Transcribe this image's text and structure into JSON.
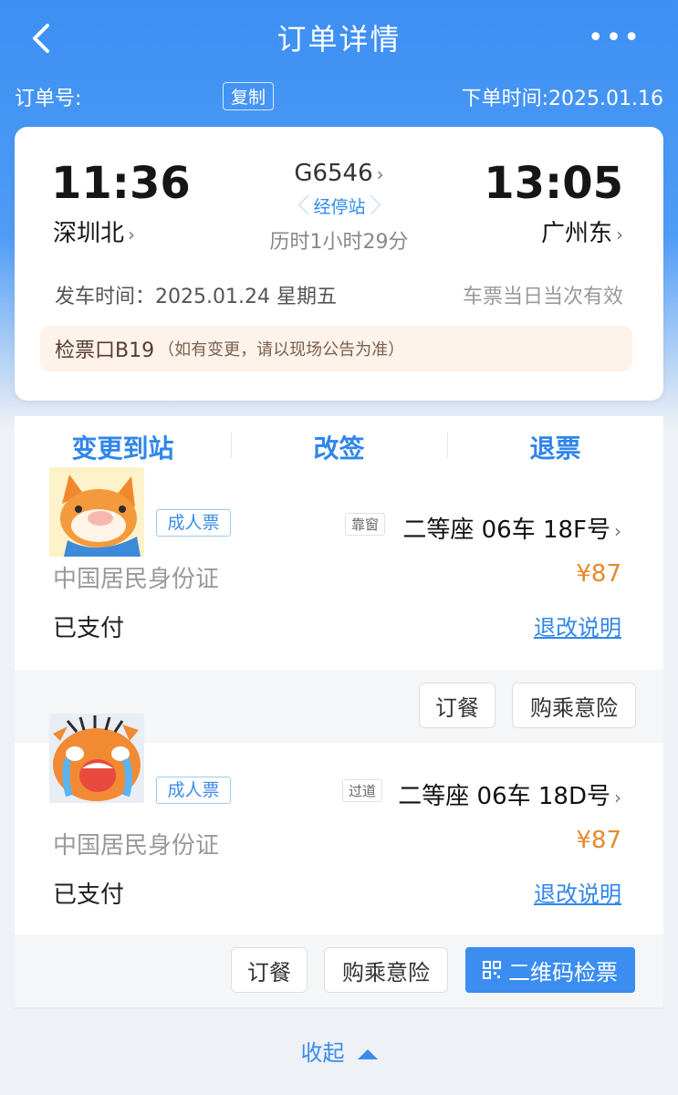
{
  "header": {
    "title": "订单详情",
    "more": "•••"
  },
  "order": {
    "number_label": "订单号:",
    "copy_label": "复制",
    "time_label": "下单时间:2025.01.16"
  },
  "trip": {
    "departure": {
      "time": "11:36",
      "station": "深圳北"
    },
    "arrival": {
      "time": "13:05",
      "station": "广州东"
    },
    "train_number": "G6546",
    "stops_label": "经停站",
    "duration": "历时1小时29分",
    "depart_time": "发车时间：2025.01.24 星期五",
    "validity": "车票当日当次有效",
    "gate": "检票口B19",
    "gate_note": "（如有变更，请以现场公告为准）"
  },
  "actions": [
    "变更到站",
    "改签",
    "退票"
  ],
  "passengers": [
    {
      "ticket_type": "成人票",
      "seat_position": "靠窗",
      "seat": "二等座 06车 18F号",
      "id_type": "中国居民身份证",
      "price": "¥87",
      "status": "已支付",
      "rules": "退改说明"
    },
    {
      "ticket_type": "成人票",
      "seat_position": "过道",
      "seat": "二等座 06车 18D号",
      "id_type": "中国居民身份证",
      "price": "¥87",
      "status": "已支付",
      "rules": "退改说明"
    }
  ],
  "services": {
    "meal": "订餐",
    "insurance": "购乘意险",
    "qr_check": "二维码检票"
  },
  "footer": {
    "collapse": "收起"
  },
  "colors": {
    "primary": "#3b8df0",
    "price": "#e58a2c",
    "gate_bg": "#fdf3ea"
  }
}
